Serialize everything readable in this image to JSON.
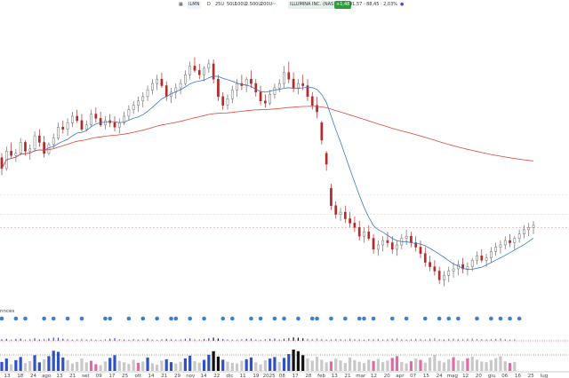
{
  "toolbar": {
    "symbol": "ILMN",
    "timeframe": "D",
    "ma_buttons": [
      "25U",
      "50U",
      "100U",
      "2.500U",
      "200U"
    ],
    "company": "ILLUMINA INC. (NAS",
    "badge": "+1,48",
    "price_info": "91,57 · 88,45 · 2,03%",
    "badge_color": "#2e9d3e",
    "accent": "#7a3bd1"
  },
  "panel_label": "nnces",
  "x_ticks": [
    "13",
    "18",
    "24",
    "ago",
    "13",
    "21",
    "set",
    "09",
    "17",
    "25",
    "ott",
    "14",
    "21",
    "29",
    "nov",
    "14",
    "22",
    "dic",
    "11",
    "19",
    "2025",
    "08",
    "17",
    "28",
    "feb",
    "13",
    "21",
    "mar",
    "12",
    "20",
    "apr",
    "07",
    "15",
    "24",
    "mag",
    "12",
    "20",
    "giu",
    "06",
    "16",
    "25",
    "lug"
  ],
  "chart_data": {
    "type": "candlestick",
    "title": "",
    "series": [
      {
        "name": "price",
        "kind": "ohlc",
        "values": [
          [
            124,
            126,
            116,
            119
          ],
          [
            119,
            129,
            118,
            127
          ],
          [
            127,
            131,
            124,
            125
          ],
          [
            125,
            128,
            122,
            126
          ],
          [
            126,
            133,
            125,
            131
          ],
          [
            131,
            132,
            125,
            127
          ],
          [
            127,
            130,
            123,
            128
          ],
          [
            128,
            136,
            127,
            134
          ],
          [
            134,
            137,
            129,
            131
          ],
          [
            131,
            134,
            124,
            126
          ],
          [
            126,
            131,
            125,
            130
          ],
          [
            130,
            135,
            128,
            133
          ],
          [
            133,
            140,
            132,
            138
          ],
          [
            138,
            141,
            135,
            137
          ],
          [
            137,
            142,
            134,
            140
          ],
          [
            140,
            145,
            138,
            143
          ],
          [
            143,
            146,
            140,
            141
          ],
          [
            141,
            144,
            136,
            137
          ],
          [
            137,
            141,
            136,
            139
          ],
          [
            139,
            146,
            138,
            144
          ],
          [
            144,
            147,
            140,
            142
          ],
          [
            142,
            145,
            138,
            139
          ],
          [
            139,
            143,
            137,
            141
          ],
          [
            141,
            144,
            138,
            140
          ],
          [
            140,
            143,
            136,
            138
          ],
          [
            138,
            142,
            135,
            140
          ],
          [
            140,
            145,
            139,
            143
          ],
          [
            143,
            148,
            141,
            146
          ],
          [
            146,
            150,
            144,
            148
          ],
          [
            148,
            152,
            145,
            150
          ],
          [
            150,
            154,
            147,
            152
          ],
          [
            152,
            157,
            150,
            155
          ],
          [
            155,
            160,
            153,
            158
          ],
          [
            158,
            162,
            155,
            160
          ],
          [
            160,
            163,
            156,
            157
          ],
          [
            157,
            159,
            150,
            152
          ],
          [
            152,
            156,
            149,
            154
          ],
          [
            154,
            158,
            151,
            156
          ],
          [
            156,
            160,
            153,
            158
          ],
          [
            158,
            164,
            157,
            162
          ],
          [
            162,
            168,
            160,
            166
          ],
          [
            166,
            170,
            163,
            164
          ],
          [
            164,
            167,
            160,
            162
          ],
          [
            162,
            166,
            159,
            165
          ],
          [
            165,
            169,
            163,
            167
          ],
          [
            167,
            169,
            158,
            160
          ],
          [
            160,
            162,
            150,
            152
          ],
          [
            152,
            154,
            146,
            148
          ],
          [
            148,
            153,
            146,
            151
          ],
          [
            151,
            157,
            149,
            155
          ],
          [
            155,
            160,
            152,
            158
          ],
          [
            158,
            162,
            155,
            157
          ],
          [
            157,
            161,
            154,
            160
          ],
          [
            160,
            164,
            156,
            158
          ],
          [
            158,
            160,
            152,
            154
          ],
          [
            154,
            157,
            148,
            150
          ],
          [
            150,
            153,
            147,
            149
          ],
          [
            149,
            155,
            148,
            153
          ],
          [
            153,
            158,
            151,
            156
          ],
          [
            156,
            160,
            154,
            158
          ],
          [
            158,
            166,
            156,
            163
          ],
          [
            163,
            168,
            158,
            160
          ],
          [
            160,
            163,
            154,
            156
          ],
          [
            156,
            160,
            153,
            158
          ],
          [
            158,
            162,
            155,
            157
          ],
          [
            157,
            160,
            150,
            152
          ],
          [
            152,
            154,
            146,
            148
          ],
          [
            148,
            152,
            142,
            145
          ],
          [
            140,
            141,
            130,
            132
          ],
          [
            126,
            127,
            118,
            121
          ],
          [
            110,
            112,
            100,
            102
          ],
          [
            102,
            104,
            96,
            98
          ],
          [
            98,
            101,
            95,
            99
          ],
          [
            99,
            102,
            94,
            96
          ],
          [
            96,
            99,
            92,
            94
          ],
          [
            94,
            97,
            90,
            92
          ],
          [
            92,
            95,
            86,
            88
          ],
          [
            88,
            92,
            85,
            90
          ],
          [
            90,
            93,
            86,
            87
          ],
          [
            87,
            89,
            80,
            82
          ],
          [
            82,
            86,
            79,
            84
          ],
          [
            84,
            88,
            81,
            86
          ],
          [
            86,
            90,
            83,
            85
          ],
          [
            85,
            88,
            80,
            82
          ],
          [
            82,
            86,
            79,
            84
          ],
          [
            84,
            89,
            82,
            87
          ],
          [
            87,
            91,
            84,
            88
          ],
          [
            88,
            90,
            83,
            85
          ],
          [
            85,
            88,
            81,
            83
          ],
          [
            83,
            86,
            78,
            80
          ],
          [
            80,
            83,
            74,
            76
          ],
          [
            76,
            79,
            72,
            74
          ],
          [
            74,
            77,
            70,
            72
          ],
          [
            72,
            74,
            66,
            68
          ],
          [
            68,
            72,
            65,
            70
          ],
          [
            70,
            74,
            67,
            72
          ],
          [
            72,
            76,
            69,
            73
          ],
          [
            73,
            77,
            70,
            75
          ],
          [
            75,
            78,
            71,
            73
          ],
          [
            73,
            76,
            70,
            74
          ],
          [
            74,
            78,
            72,
            77
          ],
          [
            77,
            81,
            75,
            79
          ],
          [
            79,
            82,
            76,
            77
          ],
          [
            77,
            80,
            74,
            78
          ],
          [
            78,
            83,
            76,
            81
          ],
          [
            81,
            85,
            79,
            83
          ],
          [
            83,
            86,
            80,
            84
          ],
          [
            84,
            88,
            82,
            86
          ],
          [
            86,
            89,
            83,
            85
          ],
          [
            85,
            88,
            82,
            87
          ],
          [
            87,
            91,
            85,
            89
          ],
          [
            89,
            93,
            87,
            91
          ],
          [
            91,
            94,
            88,
            92
          ],
          [
            92,
            95,
            89,
            93
          ]
        ]
      },
      {
        "name": "sma_short",
        "kind": "line",
        "color": "#3a78c9"
      },
      {
        "name": "sma_long",
        "kind": "line",
        "color": "#d9463c"
      }
    ],
    "yrange": [
      60,
      180
    ],
    "horizontal_levels": [
      107,
      98,
      92
    ],
    "dividends": [
      0,
      3,
      5,
      9,
      11,
      14,
      17,
      22,
      23,
      27,
      30,
      33,
      36,
      37,
      40,
      43,
      47,
      49,
      53,
      55,
      58,
      60,
      63,
      66,
      67,
      70,
      73,
      76,
      77,
      79,
      83,
      86,
      90,
      93,
      95,
      97,
      101,
      104,
      106,
      108,
      110
    ],
    "volume": [
      40,
      55,
      30,
      48,
      62,
      35,
      44,
      70,
      38,
      52,
      66,
      90,
      85,
      60,
      48,
      33,
      40,
      55,
      38,
      45,
      30,
      26,
      42,
      58,
      70,
      45,
      38,
      31,
      50,
      36,
      42,
      60,
      34,
      28,
      46,
      52,
      39,
      33,
      41,
      56,
      68,
      44,
      37,
      49,
      72,
      88,
      64,
      50,
      41,
      36,
      33,
      45,
      52,
      60,
      38,
      29,
      47,
      55,
      62,
      40,
      58,
      75,
      95,
      88,
      70,
      56,
      45,
      63,
      50,
      38,
      42,
      55,
      47,
      36,
      60,
      48,
      41,
      35,
      50,
      44,
      53,
      39,
      46,
      58,
      66,
      40,
      34,
      43,
      55,
      49,
      37,
      60,
      71,
      45,
      38,
      52,
      61,
      47,
      44,
      56,
      64,
      50,
      42,
      39,
      48,
      57,
      66,
      43,
      35,
      40
    ],
    "volume_colors": [
      "blue",
      "blue",
      "grey",
      "blue",
      "blue",
      "grey",
      "grey",
      "blue",
      "blue",
      "grey",
      "blue",
      "blue",
      "blue",
      "blue",
      "grey",
      "grey",
      "grey",
      "grey",
      "grey",
      "pink",
      "pink",
      "grey",
      "grey",
      "blue",
      "blue",
      "grey",
      "grey",
      "grey",
      "grey",
      "pink",
      "grey",
      "blue",
      "grey",
      "grey",
      "grey",
      "blue",
      "blue",
      "grey",
      "grey",
      "blue",
      "blue",
      "grey",
      "grey",
      "blue",
      "blue",
      "black",
      "black",
      "blue",
      "grey",
      "grey",
      "grey",
      "grey",
      "blue",
      "blue",
      "grey",
      "grey",
      "grey",
      "blue",
      "blue",
      "grey",
      "blue",
      "blue",
      "black",
      "black",
      "black",
      "grey",
      "grey",
      "grey",
      "grey",
      "grey",
      "pink",
      "grey",
      "grey",
      "grey",
      "grey",
      "grey",
      "grey",
      "grey",
      "grey",
      "pink",
      "grey",
      "grey",
      "grey",
      "pink",
      "pink",
      "grey",
      "grey",
      "pink",
      "grey",
      "pink",
      "grey",
      "grey",
      "grey",
      "grey",
      "grey",
      "grey",
      "pink",
      "grey",
      "grey",
      "pink",
      "grey",
      "grey",
      "grey",
      "grey",
      "grey",
      "grey",
      "grey",
      "grey",
      "pink",
      "grey"
    ]
  }
}
